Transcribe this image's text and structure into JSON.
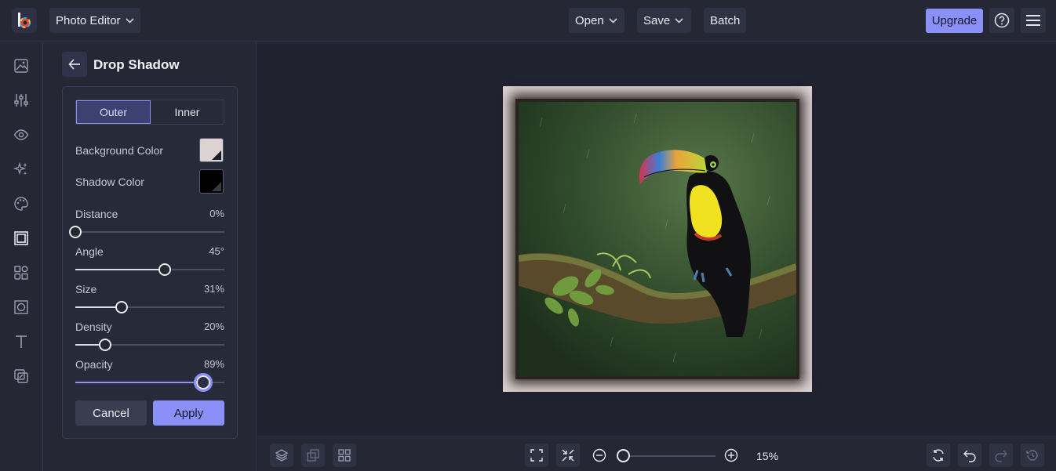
{
  "topbar": {
    "app_menu": "Photo Editor",
    "open": "Open",
    "save": "Save",
    "batch": "Batch",
    "upgrade": "Upgrade"
  },
  "panel": {
    "title": "Drop Shadow",
    "tabs": [
      "Outer",
      "Inner"
    ],
    "active_tab": "Outer",
    "background_color_label": "Background Color",
    "background_color": "#dcd2d2",
    "shadow_color_label": "Shadow Color",
    "shadow_color": "#000000",
    "sliders": [
      {
        "label": "Distance",
        "display": "0%",
        "value": 0
      },
      {
        "label": "Angle",
        "display": "45°",
        "value": 0.6
      },
      {
        "label": "Size",
        "display": "31%",
        "value": 0.31
      },
      {
        "label": "Density",
        "display": "20%",
        "value": 0.2
      },
      {
        "label": "Opacity",
        "display": "89%",
        "value": 0.86
      }
    ],
    "cancel": "Cancel",
    "apply": "Apply"
  },
  "bottombar": {
    "zoom": "15%",
    "zoom_level": 0
  },
  "colors": {
    "accent": "#8b8ff8",
    "background": "#202230",
    "panel": "#252734"
  }
}
